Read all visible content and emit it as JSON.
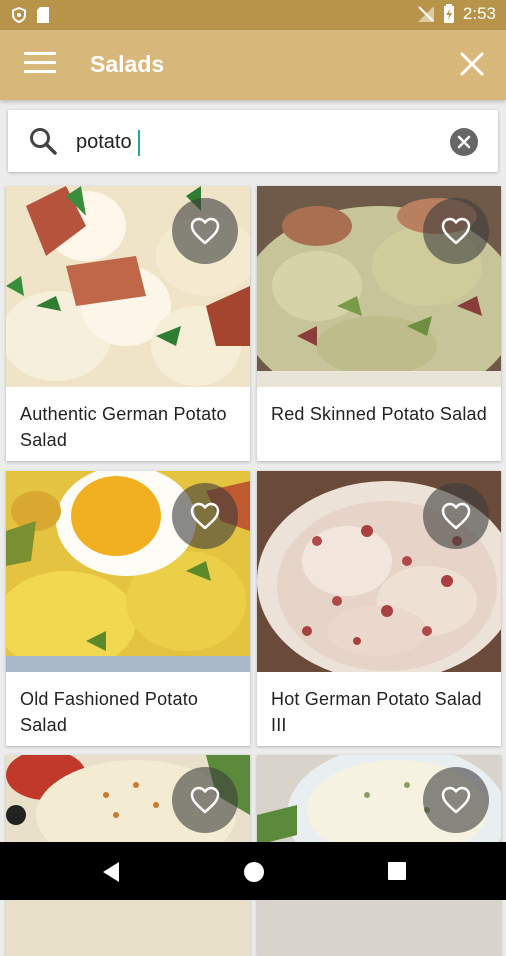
{
  "status_bar": {
    "time": "2:53"
  },
  "app_bar": {
    "title": "Salads",
    "menu_icon": "hamburger-menu-icon",
    "close_icon": "close-icon"
  },
  "search": {
    "value": "potato",
    "search_icon": "search-icon",
    "clear_icon": "clear-icon"
  },
  "results": [
    {
      "title": "Authentic German Potato Salad"
    },
    {
      "title": "Red Skinned Potato Salad"
    },
    {
      "title": "Old Fashioned Potato Salad"
    },
    {
      "title": "Hot German Potato Salad III"
    },
    {
      "title": ""
    },
    {
      "title": ""
    }
  ],
  "colors": {
    "status_bar": "#b8944a",
    "app_bar": "#d8b87a",
    "accent": "#26a69a"
  }
}
